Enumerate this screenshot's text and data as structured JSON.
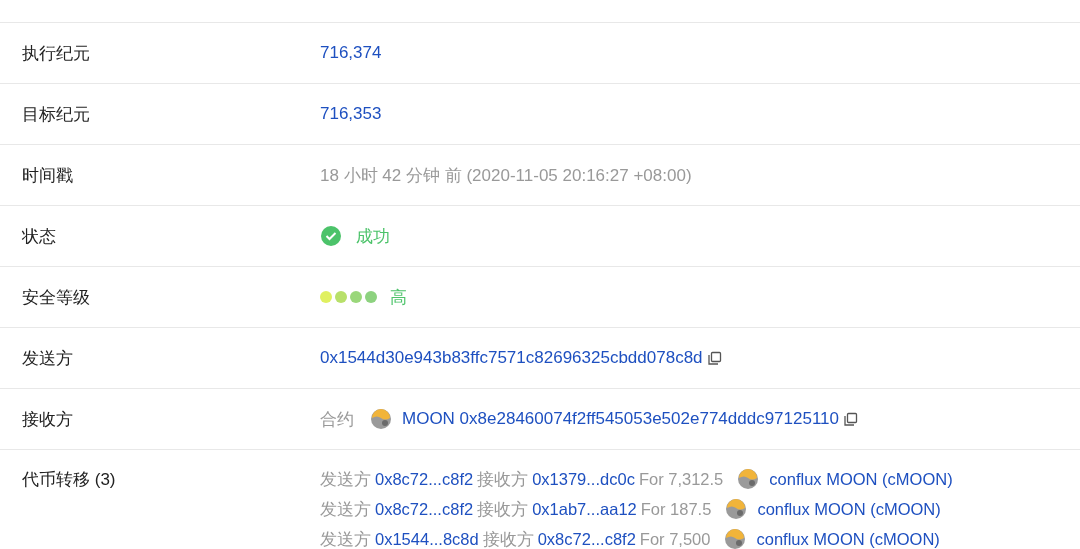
{
  "rows": [
    {
      "kind": "link",
      "label": "执行纪元",
      "value": "716,374"
    },
    {
      "kind": "link",
      "label": "目标纪元",
      "value": "716,353"
    },
    {
      "kind": "muted",
      "label": "时间戳",
      "value": "18 小时 42 分钟 前 (2020-11-05 20:16:27 +08:00)"
    },
    {
      "kind": "status",
      "label": "状态",
      "success": true,
      "value": "成功"
    },
    {
      "kind": "security",
      "label": "安全等级",
      "value": "高",
      "dots": [
        {
          "color": "#e0f060"
        },
        {
          "color": "#b8e06a"
        },
        {
          "color": "#9ad77a"
        },
        {
          "color": "#8dd27f"
        }
      ]
    },
    {
      "kind": "address",
      "label": "发送方",
      "value": "0x1544d30e943b83ffc7571c82696325cbdd078c8d"
    },
    {
      "kind": "contract",
      "label": "接收方",
      "prefix": "合约",
      "value": "MOON 0x8e28460074f2ff545053e502e774dddc97125110"
    }
  ],
  "transfers": {
    "label": "代币转移 (3)",
    "items": [
      {
        "from_label": "发送方",
        "from": "0x8c72...c8f2",
        "to_label": "接收方",
        "to": "0x1379...dc0c",
        "amount": "For 7,312.5",
        "token": "conflux MOON (cMOON)"
      },
      {
        "from_label": "发送方",
        "from": "0x8c72...c8f2",
        "to_label": "接收方",
        "to": "0x1ab7...aa12",
        "amount": "For 187.5",
        "token": "conflux MOON (cMOON)"
      },
      {
        "from_label": "发送方",
        "from": "0x1544...8c8d",
        "to_label": "接收方",
        "to": "0x8c72...c8f2",
        "amount": "For 7,500",
        "token": "conflux MOON (cMOON)"
      }
    ]
  }
}
